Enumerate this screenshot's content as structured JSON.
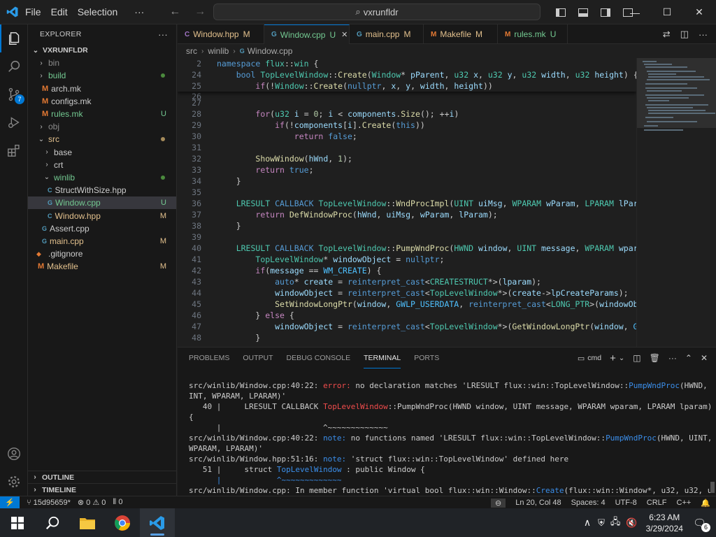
{
  "titlebar": {
    "menus": [
      "File",
      "Edit",
      "Selection"
    ],
    "more": "···",
    "search_text": "vxrunfldr",
    "window_buttons": [
      "—",
      "☐",
      "✕"
    ]
  },
  "activity": {
    "source_control_badge": "7"
  },
  "explorer": {
    "header": "EXPLORER",
    "more": "···",
    "root": "VXRUNFLDR",
    "items": [
      {
        "label": "bin"
      },
      {
        "label": "build"
      },
      {
        "label": "arch.mk"
      },
      {
        "label": "configs.mk"
      },
      {
        "label": "rules.mk",
        "status": "U"
      },
      {
        "label": "obj"
      },
      {
        "label": "src"
      },
      {
        "label": "base"
      },
      {
        "label": "crt"
      },
      {
        "label": "winlib"
      },
      {
        "label": "StructWithSize.hpp"
      },
      {
        "label": "Window.cpp",
        "status": "U"
      },
      {
        "label": "Window.hpp",
        "status": "M"
      },
      {
        "label": "Assert.cpp"
      },
      {
        "label": "main.cpp",
        "status": "M"
      },
      {
        "label": ".gitignore"
      },
      {
        "label": "Makefile",
        "status": "M"
      }
    ],
    "outline": "OUTLINE",
    "timeline": "TIMELINE"
  },
  "tabs": [
    {
      "label": "Window.hpp",
      "status": "M"
    },
    {
      "label": "Window.cpp",
      "status": "U",
      "close": "✕"
    },
    {
      "label": "main.cpp",
      "status": "M"
    },
    {
      "label": "Makefile",
      "status": "M"
    },
    {
      "label": "rules.mk",
      "status": "U"
    }
  ],
  "breadcrumb": [
    "src",
    "winlib",
    "Window.cpp"
  ],
  "editor": {
    "line_numbers": [
      "2",
      "24",
      "25",
      "26",
      "27",
      "28",
      "29",
      "30",
      "31",
      "32",
      "33",
      "34",
      "35",
      "36",
      "37",
      "38",
      "39",
      "40",
      "41",
      "42",
      "43",
      "44",
      "45",
      "46",
      "47",
      "48"
    ]
  },
  "panel": {
    "tabs": [
      "PROBLEMS",
      "OUTPUT",
      "DEBUG CONSOLE",
      "TERMINAL",
      "PORTS"
    ],
    "shell": "cmd",
    "terminal_lines": [
      "src/winlib/Window.cpp:40:22: ",
      "error:",
      " no declaration matches 'LRESULT flux::win::TopLevelWindow::",
      "PumpWndProc",
      "(HWND, U",
      "INT, WPARAM, LPARAM)'",
      "   40 |     LRESULT CALLBACK ",
      "TopLevelWindow",
      "::PumpWndProc(HWND window, UINT message, WPARAM wparam, LPARAM lparam)",
      "{",
      "      |                      ^~~~~~~~~~~~~~",
      "src/winlib/Window.cpp:40:22: ",
      "note:",
      " no functions named 'LRESULT flux::win::TopLevelWindow::",
      "PumpWndProc",
      "(HWND, UINT,",
      "WPARAM, LPARAM)'",
      "src/winlib/Window.hpp:51:16: ",
      "note:",
      " 'struct flux::win::TopLevelWindow' defined here",
      "   51 |     struct ",
      "TopLevelWindow",
      " : public Window {",
      "      |            ^~~~~~~~~~~~~~",
      "src/winlib/Window.cpp: In member function 'virtual bool flux::win::Window::",
      "Create",
      "(flux::win::Window*, u32, u32, u3"
    ]
  },
  "statusbar": {
    "remote": "⚡",
    "branch": "15d95659*",
    "errors": "0",
    "warnings": "0",
    "info": "0",
    "position": "Ln 20, Col 48",
    "spaces": "Spaces: 4",
    "encoding": "UTF-8",
    "eol": "CRLF",
    "language": "C++"
  },
  "taskbar": {
    "time": "6:23 AM",
    "date": "3/29/2024",
    "notifications": "6"
  },
  "colors": {
    "accent": "#0078d4",
    "modified": "#e2c08d",
    "untracked": "#73c991",
    "error": "#f14c4c"
  }
}
